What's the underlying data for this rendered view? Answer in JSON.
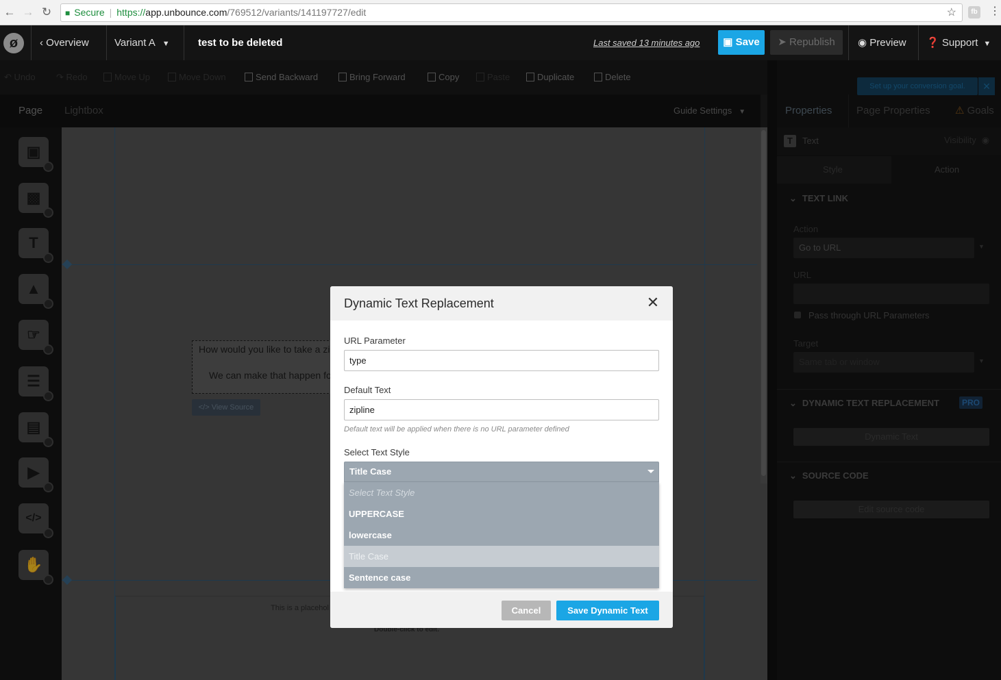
{
  "browser": {
    "secure_label": "Secure",
    "url_scheme": "https://",
    "url_host": "app.unbounce.com",
    "url_path": "/769512/variants/141197727/edit",
    "extension_label": "fb"
  },
  "topbar": {
    "overview_label": "Overview",
    "variant_label": "Variant A",
    "page_title": "test to be deleted",
    "last_saved": "Last saved  13 minutes ago",
    "save_label": "Save",
    "republish_label": "Republish",
    "preview_label": "Preview",
    "support_label": "Support"
  },
  "toolbar": {
    "undo": "Undo",
    "redo": "Redo",
    "move_up": "Move Up",
    "move_down": "Move Down",
    "send_backward": "Send Backward",
    "bring_forward": "Bring Forward",
    "copy": "Copy",
    "paste": "Paste",
    "duplicate": "Duplicate",
    "delete": "Delete"
  },
  "page_tabs": {
    "page": "Page",
    "lightbox": "Lightbox",
    "guide_settings": "Guide Settings"
  },
  "canvas": {
    "text_line1": "How would you like to take a zi",
    "text_line2": "We can make that happen fo",
    "view_source": "</> View Source",
    "placeholder": "This is a placehol",
    "double_click": "Double-click to edit."
  },
  "right_panel": {
    "tooltip": "Set up your conversion goal.",
    "tab_properties": "Properties",
    "tab_page_properties": "Page Properties",
    "tab_goals": "Goals",
    "element_type": "Text",
    "visibility": "Visibility",
    "subtab_style": "Style",
    "subtab_action": "Action",
    "section_text_link": "TEXT LINK",
    "action_label": "Action",
    "action_value": "Go to URL",
    "url_label": "URL",
    "pass_through": "Pass through URL Parameters",
    "target_label": "Target",
    "target_value": "Same tab or window",
    "section_dtr": "DYNAMIC TEXT REPLACEMENT",
    "pro_badge": "PRO",
    "dynamic_text_button": "Dynamic Text",
    "section_source": "SOURCE CODE",
    "edit_source_button": "Edit source code"
  },
  "modal": {
    "title": "Dynamic Text Replacement",
    "url_param_label": "URL Parameter",
    "url_param_value": "type",
    "default_text_label": "Default Text",
    "default_text_value": "zipline",
    "default_hint": "Default text will be applied when there is no URL parameter defined",
    "style_label": "Select Text Style",
    "style_selected": "Title Case",
    "style_options": [
      "Select Text Style",
      "UPPERCASE",
      "lowercase",
      "Title Case",
      "Sentence case"
    ],
    "cancel_label": "Cancel",
    "save_label": "Save Dynamic Text"
  }
}
